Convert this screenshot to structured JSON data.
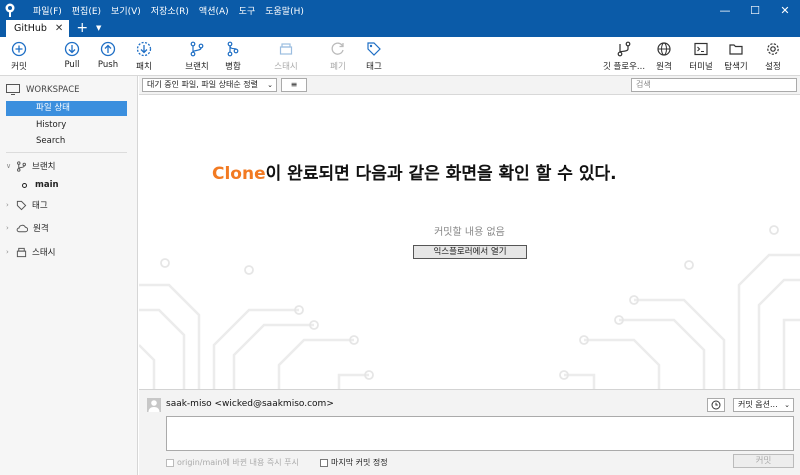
{
  "menu": [
    "파일(F)",
    "편집(E)",
    "보기(V)",
    "저장소(R)",
    "액션(A)",
    "도구",
    "도움말(H)"
  ],
  "window": {
    "minimize": "—",
    "maximize": "☐",
    "close": "✕"
  },
  "tabs": [
    {
      "label": "GitHub",
      "close": "✕"
    }
  ],
  "tab_add": "+",
  "tab_dropdown": "▼",
  "toolbar": {
    "commit": "커밋",
    "pull": "Pull",
    "push": "Push",
    "fetch": "패치",
    "branch": "브랜치",
    "merge": "병합",
    "stash": "스태시",
    "discard": "폐기",
    "tag": "태그",
    "git_flow": "깃 플로우...",
    "remote": "원격",
    "terminal": "터미널",
    "explorer": "탐색기",
    "settings": "설정"
  },
  "sidebar": {
    "workspace": "WORKSPACE",
    "items": [
      "파일 상태",
      "History",
      "Search"
    ],
    "branches": "브랜치",
    "current_branch": "main",
    "tags": "태그",
    "remotes": "원격",
    "stashes": "스태시"
  },
  "filter": {
    "status_select": "대기 중인 파일, 파일 상태순 정렬",
    "view_select": "≡",
    "search_placeholder": "검색"
  },
  "main": {
    "caption_accent": "Clone",
    "caption_rest": "이 완료되면 다음과 같은 화면을 확인 할 수 있다.",
    "no_commit": "커밋할 내용 없음",
    "open_explorer": "익스플로러에서 열기"
  },
  "commit": {
    "author": "saak-miso <wicked@saakmiso.com>",
    "options": "커밋 옵션...",
    "push_now": "origin/main에 바뀐 내용 즉시 푸시",
    "amend": "마지막 커밋 정정",
    "commit_button": "커밋"
  },
  "colors": {
    "titlebar": "#0b5ba8",
    "accent": "#3b8fde",
    "highlight": "#f27a22"
  }
}
